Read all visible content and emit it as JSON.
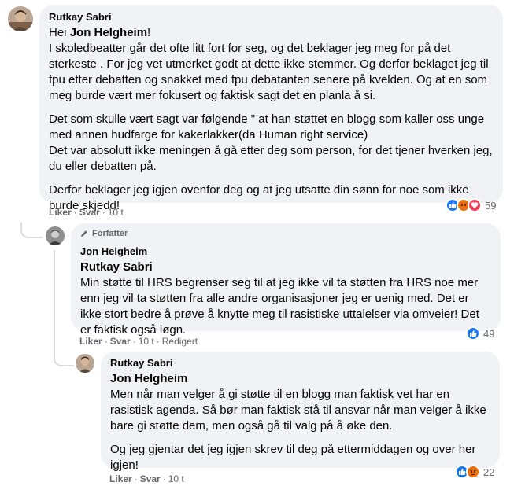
{
  "comment1": {
    "author": "Rutkay Sabri",
    "greeting_prefix": "Hei ",
    "mention": "Jon Helgheim",
    "greeting_suffix": "!",
    "para1": "I skoledbeatter går det ofte litt fort for seg, og det beklager jeg meg for på det sterkeste . For jeg vet utmerket godt at dette ikke stemmer. Og derfor beklaget jeg til fpu etter debatten og snakket med fpu debatanten senere på kvelden. Og at en som meg burde vært mer fokusert og faktisk sagt det en planla å si.",
    "para2a": "Det som skulle vært sagt var følgende \" at han støttet en blogg som kaller oss unge med annen hudfarge for kakerlakker(da Human right service)",
    "para2b": "Det var absolutt ikke meningen å gå etter deg som person, for det tjener hverken jeg, du eller debatten på.",
    "para3": "Derfor beklager jeg igjen ovenfor deg og at jeg utsatte din sønn for noe som ikke burde skjedd!",
    "like": "Liker",
    "reply": "Svar",
    "time": "10 t",
    "reaction_count": "59"
  },
  "comment2": {
    "badge": "Forfatter",
    "author": "Jon Helgheim",
    "mention": "Rutkay Sabri",
    "text": "Min støtte til HRS begrenser seg til at jeg ikke vil ta støtten fra HRS noe mer enn jeg vil ta støtten fra alle andre organisasjoner jeg er uenig med. Det er ikke stort bedre å prøve å knytte meg til rasistiske uttalelser via omveier! Det er faktisk også løgn.",
    "like": "Liker",
    "reply": "Svar",
    "time": "10 t",
    "edited": "Redigert",
    "reaction_count": "49"
  },
  "comment3": {
    "author": "Rutkay Sabri",
    "mention": "Jon Helgheim",
    "para1": "Men når man velger å gi støtte til en blogg man faktisk vet har en rasistisk agenda. Så bør man faktisk stå til ansvar når man velger å ikke bare gi støtte dem, men også gå til valg på å øke den.",
    "para2": "Og jeg gjentar det jeg igjen skrev til deg på ettermiddagen og over her igjen!",
    "like": "Liker",
    "reply": "Svar",
    "time": "10 t",
    "reaction_count": "22"
  },
  "colors": {
    "bubble": "#f0f2f5",
    "secondary_text": "#65676b",
    "like_blue": "#1877f2",
    "angry_orange": "#e9710f",
    "love_red": "#f33e58"
  },
  "icons": [
    "like-icon",
    "angry-icon",
    "love-icon",
    "pen-icon"
  ]
}
